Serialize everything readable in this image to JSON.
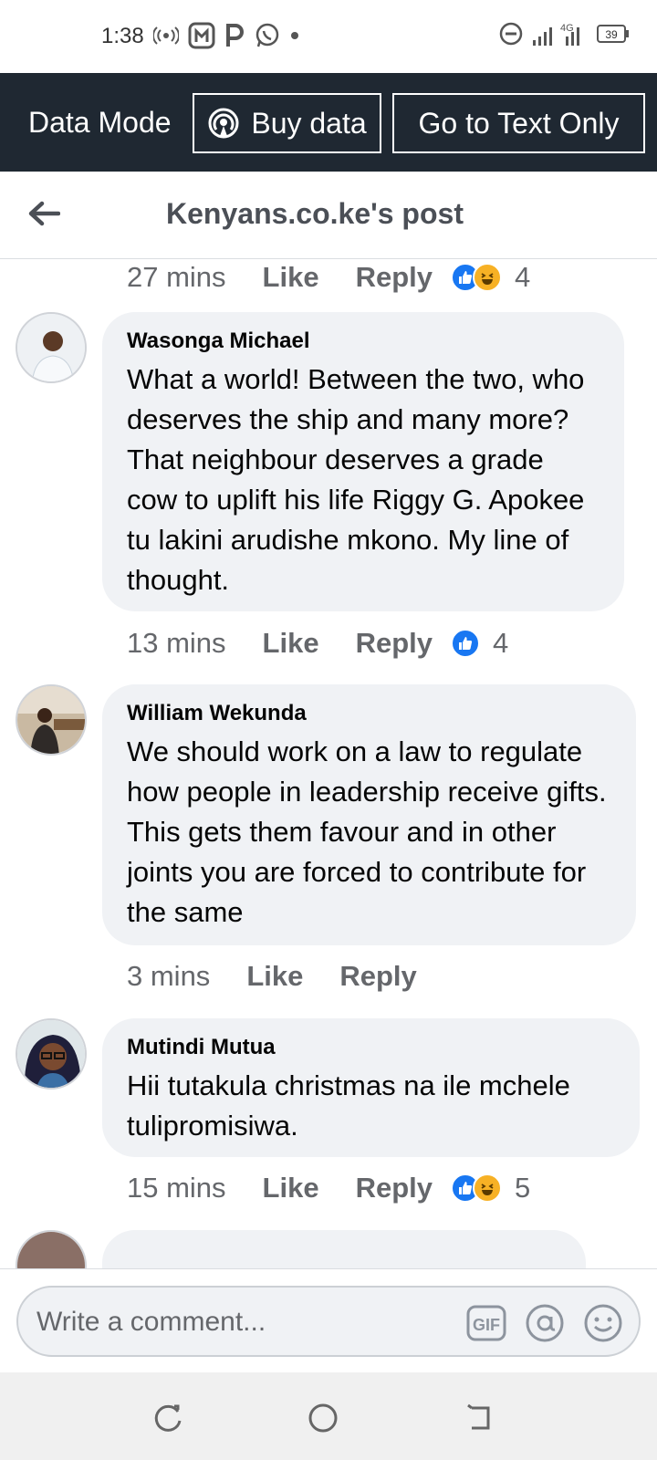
{
  "status_bar": {
    "time": "1:38",
    "battery": "39",
    "network": "4G",
    "icons": [
      "hotspot-icon",
      "app-icon",
      "p-icon",
      "whatsapp-icon",
      "dot-icon",
      "dnd-icon",
      "signal-icon",
      "battery-icon"
    ]
  },
  "data_bar": {
    "mode_label": "Data Mode",
    "buy_label": "Buy data",
    "text_only_label": "Go to Text Only"
  },
  "header": {
    "title": "Kenyans.co.ke's post",
    "back_icon": "arrow-left-icon"
  },
  "top_meta": {
    "time": "27 mins",
    "like": "Like",
    "reply": "Reply",
    "reaction_count": "4"
  },
  "comments": [
    {
      "author": "Wasonga Michael",
      "text": "What a world! Between the two, who deserves the ship and many more? That neighbour deserves a grade cow to uplift his life Riggy G. Apokee tu lakini arudishe mkono. My line of thought.",
      "time": "13 mins",
      "like": "Like",
      "reply": "Reply",
      "reaction_count": "4"
    },
    {
      "author": "William Wekunda",
      "text": "We should work on a law to regulate how people in leadership receive gifts. This gets them favour and in other joints you are forced to contribute for the same",
      "time": "3 mins",
      "like": "Like",
      "reply": "Reply"
    },
    {
      "author": "Mutindi Mutua",
      "text": "Hii tutakula christmas na ile mchele tulipromisiwa.",
      "time": "15 mins",
      "like": "Like",
      "reply": "Reply",
      "reaction_count": "5"
    }
  ],
  "composer": {
    "placeholder": "Write a comment...",
    "icons": [
      "gif-icon",
      "mention-icon",
      "emoji-icon"
    ]
  },
  "nav": {
    "icons": [
      "recents-icon",
      "home-icon",
      "back-icon"
    ]
  },
  "colors": {
    "data_bar_bg": "#1f2832",
    "bubble_bg": "#f0f2f5",
    "like_blue": "#1877f2",
    "haha_yellow": "#f7b125",
    "meta_gray": "#65676b"
  }
}
